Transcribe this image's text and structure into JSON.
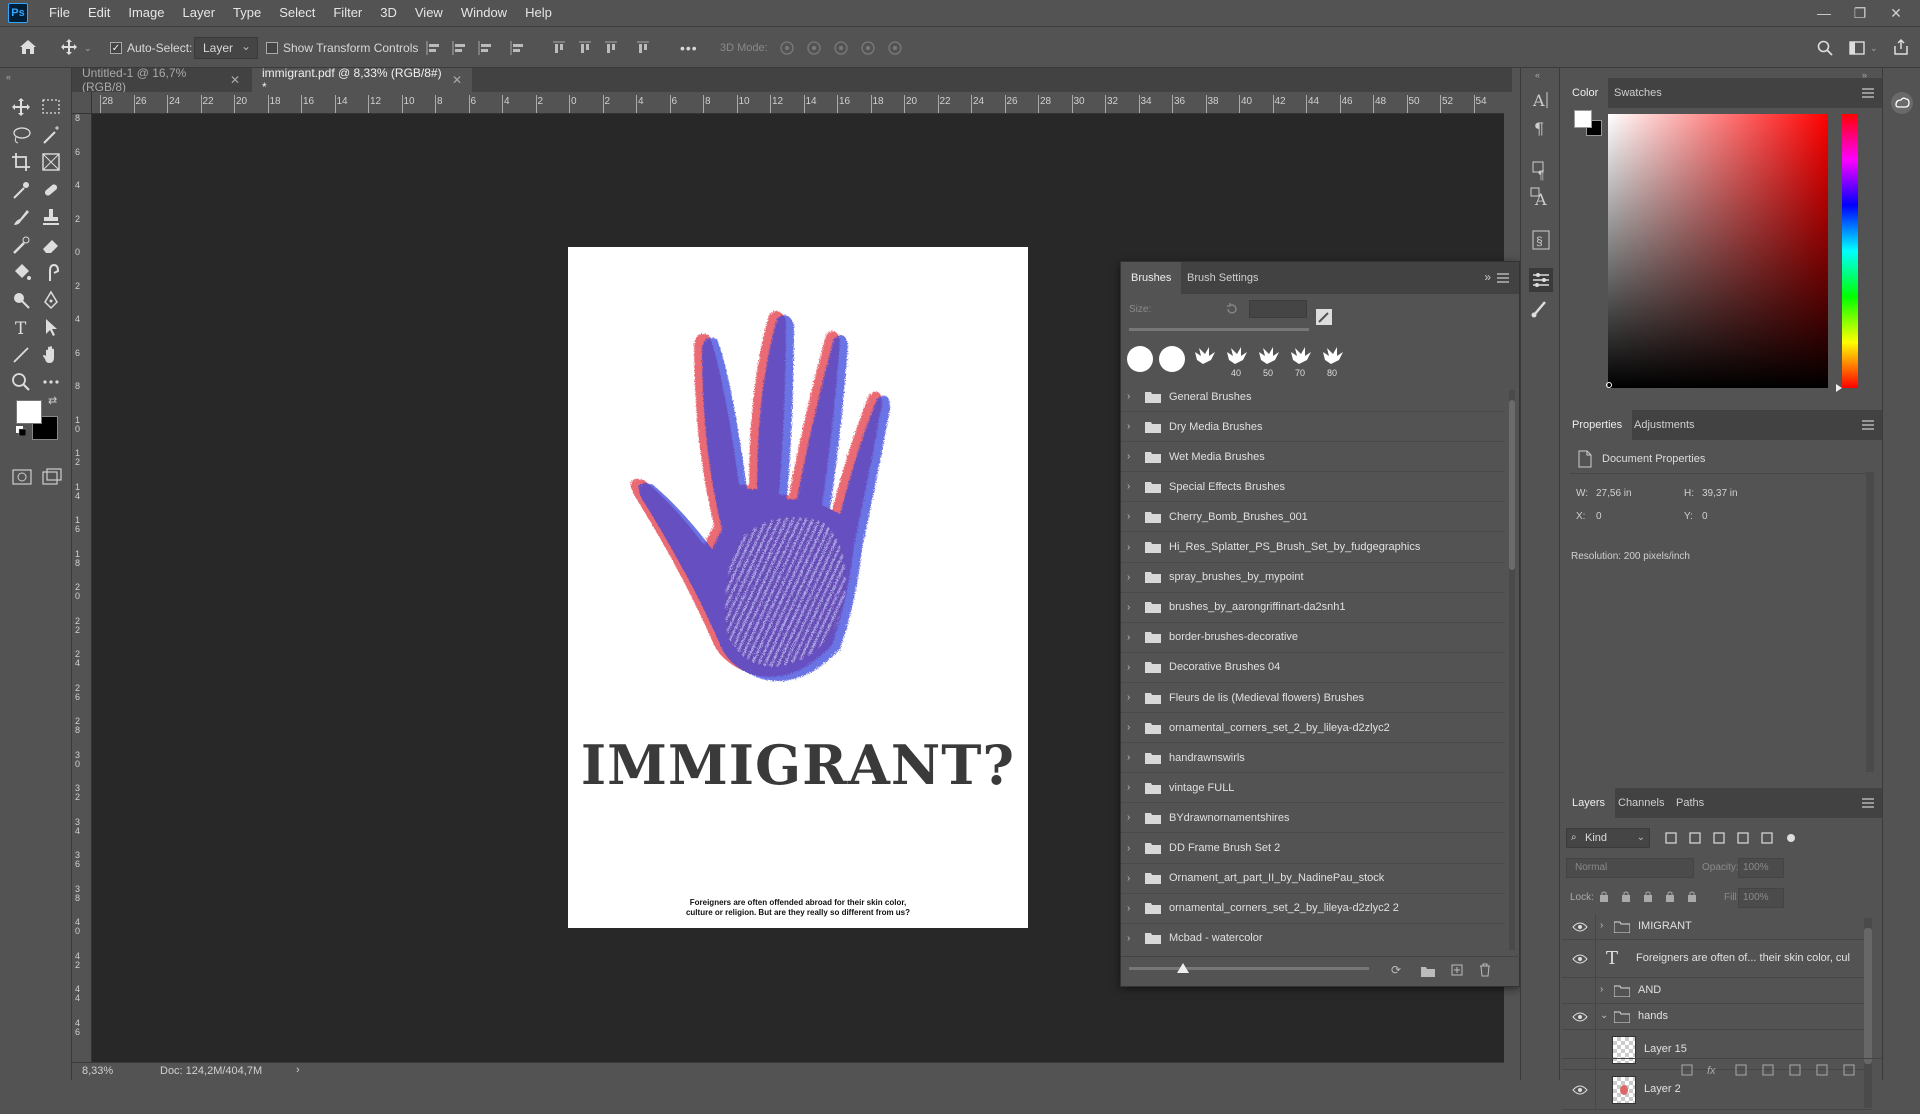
{
  "app": {
    "logo": "Ps"
  },
  "menu": [
    "File",
    "Edit",
    "Image",
    "Layer",
    "Type",
    "Select",
    "Filter",
    "3D",
    "View",
    "Window",
    "Help"
  ],
  "window_controls": {
    "minimize": "—",
    "restore": "❐",
    "close": "✕"
  },
  "options": {
    "auto_select_label": "Auto-Select:",
    "auto_select_checked": true,
    "auto_select_target": "Layer",
    "show_transform_label": "Show Transform Controls",
    "more": "•••",
    "mode_3d_label": "3D Mode:"
  },
  "tabs": [
    {
      "label": "Untitled-1 @ 16,7% (RGB/8)",
      "close": "✕",
      "active": false
    },
    {
      "label": "immigrant.pdf @ 8,33% (RGB/8#) *",
      "close": "✕",
      "active": true
    }
  ],
  "rulers": {
    "top": [
      "28",
      "26",
      "24",
      "22",
      "20",
      "18",
      "16",
      "14",
      "12",
      "10",
      "8",
      "6",
      "4",
      "2",
      "0",
      "2",
      "4",
      "6",
      "8",
      "10",
      "12",
      "14",
      "16",
      "18",
      "20",
      "22",
      "24",
      "26",
      "28",
      "30",
      "32",
      "34",
      "36",
      "38",
      "40",
      "42",
      "44",
      "46",
      "48",
      "50",
      "52",
      "54"
    ],
    "left": [
      "8",
      "6",
      "4",
      "2",
      "0",
      "2",
      "4",
      "6",
      "8",
      "1 0",
      "1 2",
      "1 4",
      "1 6",
      "1 8",
      "2 0",
      "2 2",
      "2 4",
      "2 6",
      "2 8",
      "3 0",
      "3 2",
      "3 4",
      "3 6",
      "3 8",
      "4 0",
      "4 2",
      "4 4",
      "4 6"
    ]
  },
  "document": {
    "title": "IMMIGRANT?",
    "caption_line1": "Foreigners are often offended abroad for their skin color,",
    "caption_line2": "culture or religion. But are they really so different from us?"
  },
  "status": {
    "zoom": "8,33%",
    "doc": "Doc: 124,2M/404,7M",
    "arrow": "›"
  },
  "brushes_panel": {
    "tabs": [
      "Brushes",
      "Brush Settings"
    ],
    "size_label": "Size:",
    "presets": [
      "",
      "",
      "",
      "40",
      "50",
      "70",
      "80"
    ],
    "folders": [
      "General Brushes",
      "Dry Media Brushes",
      "Wet Media Brushes",
      "Special Effects Brushes",
      "Cherry_Bomb_Brushes_001",
      "Hi_Res_Splatter_PS_Brush_Set_by_fudgegraphics",
      "spray_brushes_by_mypoint",
      "brushes_by_aarongriffinart-da2snh1",
      "border-brushes-decorative",
      "Decorative Brushes 04",
      "Fleurs de lis (Medieval flowers) Brushes",
      "ornamental_corners_set_2_by_lileya-d2zlyc2",
      "handrawnswirls",
      "vintage FULL",
      "BYdrawnornamentshires",
      "DD Frame Brush Set 2",
      "Ornament_art_part_II_by_NadinePau_stock",
      "ornamental_corners_set_2_by_lileya-d2zlyc2 2",
      "Mcbad - watercolor"
    ]
  },
  "color_panel": {
    "tabs": [
      "Color",
      "Swatches"
    ]
  },
  "properties_panel": {
    "tabs": [
      "Properties",
      "Adjustments"
    ],
    "title": "Document Properties",
    "w_label": "W:",
    "w": "27,56 in",
    "h_label": "H:",
    "h": "39,37 in",
    "x_label": "X:",
    "x": "0",
    "y_label": "Y:",
    "y": "0",
    "resolution": "Resolution: 200 pixels/inch"
  },
  "layers_panel": {
    "tabs": [
      "Layers",
      "Channels",
      "Paths"
    ],
    "filter_kind": "Kind",
    "blend_mode": "Normal",
    "opacity_label": "Opacity:",
    "opacity": "100%",
    "lock_label": "Lock:",
    "fill_label": "Fill:",
    "fill": "100%",
    "layers": [
      {
        "name": "IMIGRANT",
        "type": "group",
        "visible": true,
        "expanded": false
      },
      {
        "name": "Foreigners are often of... their skin color,  cul",
        "type": "text",
        "visible": true
      },
      {
        "name": "AND",
        "type": "group",
        "visible": false,
        "expanded": false
      },
      {
        "name": "hands",
        "type": "group",
        "visible": true,
        "expanded": true
      },
      {
        "name": "Layer 15",
        "type": "pixel",
        "visible": false
      },
      {
        "name": "Layer 2",
        "type": "pixel",
        "visible": true
      }
    ]
  },
  "colors": {
    "accent": "#31a8ff",
    "panel_bg": "#535353",
    "canvas_bg": "#282828"
  }
}
